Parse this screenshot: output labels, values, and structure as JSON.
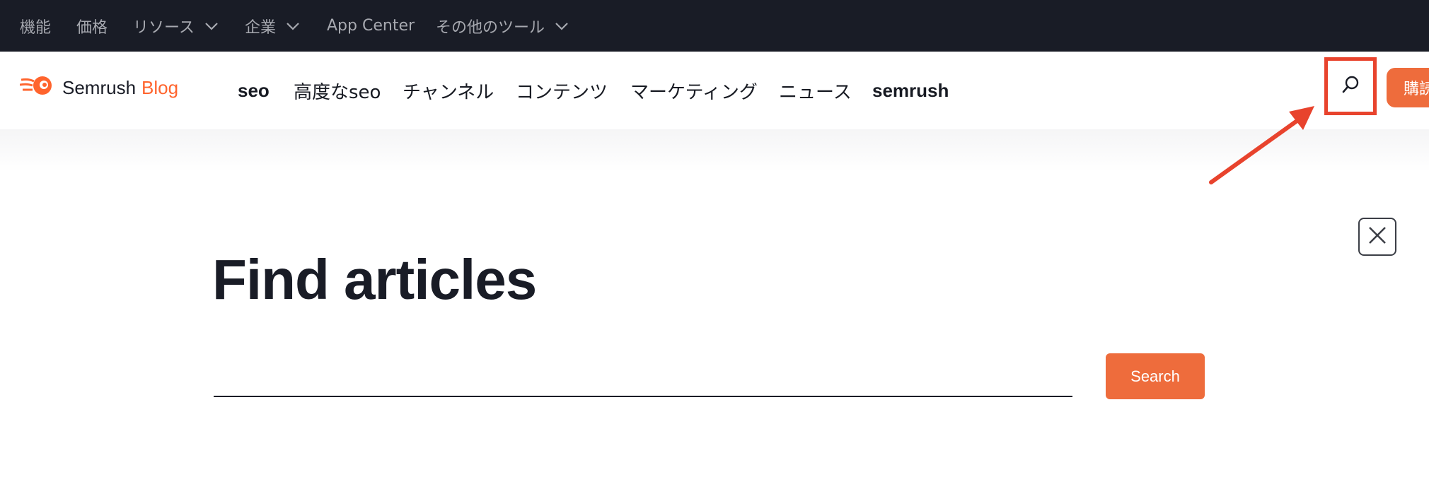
{
  "top_nav": {
    "items": [
      {
        "label": "機能"
      },
      {
        "label": "価格"
      },
      {
        "label": "リソース"
      },
      {
        "label": "企業"
      },
      {
        "label": "App Center"
      },
      {
        "label": "その他のツール"
      }
    ]
  },
  "header": {
    "logo": {
      "brand": "Semrush",
      "sub": "Blog"
    },
    "nav": [
      {
        "label": "seo"
      },
      {
        "label": "高度なseo"
      },
      {
        "label": "チャンネル"
      },
      {
        "label": "コンテンツ"
      },
      {
        "label": "マーケティング"
      },
      {
        "label": "ニュース"
      },
      {
        "label": "semrush"
      }
    ],
    "subscribe_label": "購読"
  },
  "search": {
    "title": "Find articles",
    "button_label": "Search"
  },
  "colors": {
    "top_bar_bg": "#191c26",
    "accent": "#ee6c3c",
    "highlight": "#e8432d"
  },
  "icons": [
    "chevron-down-icon",
    "semrush-logo-icon",
    "search-icon",
    "close-icon",
    "annotation-arrow-icon"
  ]
}
